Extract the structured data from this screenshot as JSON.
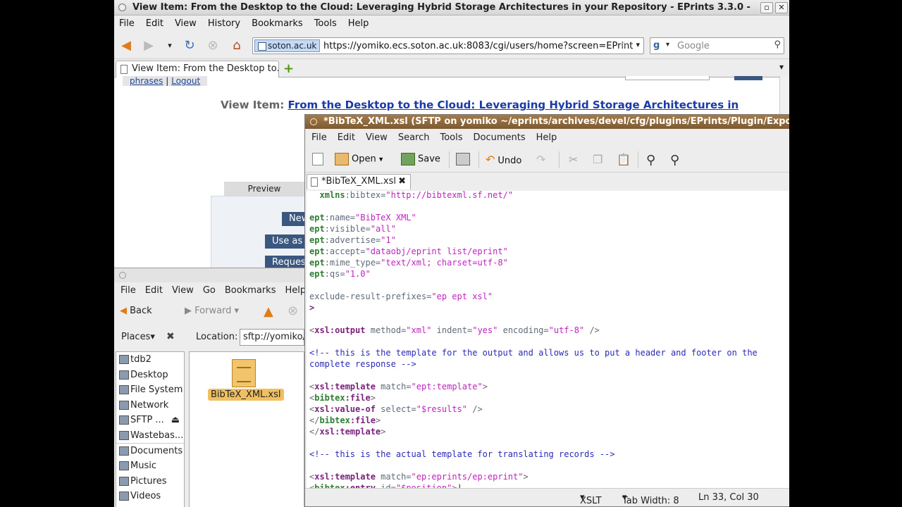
{
  "firefox": {
    "title": "View Item: From the Desktop to the Cloud: Leveraging Hybrid Storage Architectures in your Repository - EPrints 3.3.0 -",
    "menu": [
      "File",
      "Edit",
      "View",
      "History",
      "Bookmarks",
      "Tools",
      "Help"
    ],
    "site_identity": "soton.ac.uk",
    "url": "https://yomiko.ecs.soton.ac.uk:8083/cgi/users/home?screen=EPrint",
    "search_placeholder": "Google",
    "tab_title": "View Item: From the Desktop to...",
    "page": {
      "link_phrases": "phrases",
      "link_separator": "|",
      "link_logout": "Logout",
      "view_item_label": "View Item:",
      "view_item_title": "From the Desktop to the Cloud: Leveraging Hybrid Storage Architectures in",
      "preview_tab": "Preview",
      "btn_new": "New",
      "btn_use_as": "Use as",
      "btn_request": "Request"
    }
  },
  "gedit": {
    "title": "*BibTeX_XML.xsl (SFTP on yomiko ~/eprints/archives/devel/cfg/plugins/EPrints/Plugin/Expor",
    "menu": [
      "File",
      "Edit",
      "View",
      "Search",
      "Tools",
      "Documents",
      "Help"
    ],
    "toolbar": {
      "open": "Open",
      "save": "Save",
      "undo": "Undo"
    },
    "tab": "*BibTeX_XML.xsl",
    "status": {
      "mode": "XSLT",
      "tab_width": "Tab Width: 8",
      "position": "Ln 33, Col 30"
    }
  },
  "nautilus": {
    "menu": [
      "File",
      "Edit",
      "View",
      "Go",
      "Bookmarks",
      "Help"
    ],
    "back": "Back",
    "forward": "Forward",
    "places_label": "Places",
    "location_label": "Location:",
    "location_value": "sftp://yomiko/",
    "places": [
      "tdb2",
      "Desktop",
      "File System",
      "Network",
      "SFTP ...",
      "Wastebas...",
      "Documents",
      "Music",
      "Pictures",
      "Videos"
    ],
    "file_name": "BibTeX_XML.xsl"
  }
}
